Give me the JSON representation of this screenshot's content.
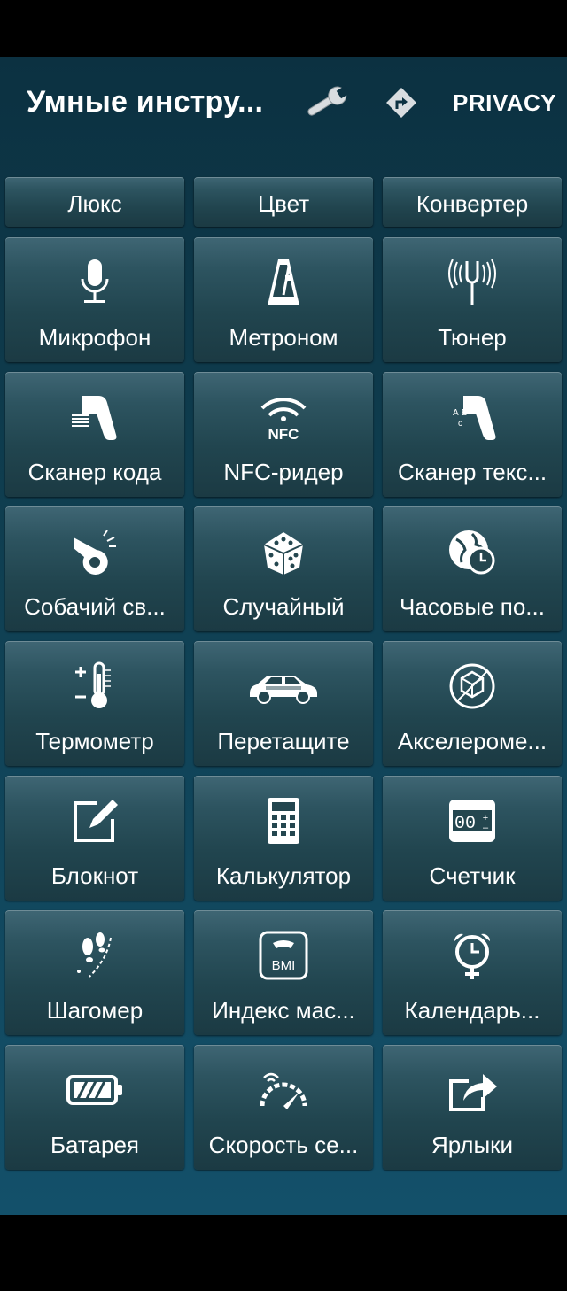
{
  "toolbar": {
    "title": "Умные инстру...",
    "wrench_icon": "wrench-icon",
    "directions_icon": "directions-icon",
    "privacy_label": "PRIVACY"
  },
  "tiles": [
    {
      "label": "Люкс",
      "icon": "none"
    },
    {
      "label": "Цвет",
      "icon": "none"
    },
    {
      "label": "Конвертер",
      "icon": "none"
    },
    {
      "label": "Микрофон",
      "icon": "microphone-icon"
    },
    {
      "label": "Метроном",
      "icon": "metronome-icon"
    },
    {
      "label": "Тюнер",
      "icon": "tuning-fork-icon"
    },
    {
      "label": "Сканер кода",
      "icon": "barcode-scanner-icon"
    },
    {
      "label": "NFC-ридер",
      "icon": "nfc-icon"
    },
    {
      "label": "Сканер текс...",
      "icon": "text-scanner-icon"
    },
    {
      "label": "Собачий св...",
      "icon": "whistle-icon"
    },
    {
      "label": "Случайный",
      "icon": "dice-icon"
    },
    {
      "label": "Часовые по...",
      "icon": "world-clock-icon"
    },
    {
      "label": "Термометр",
      "icon": "thermometer-icon"
    },
    {
      "label": "Перетащите",
      "icon": "taxi-car-icon"
    },
    {
      "label": "Акселероме...",
      "icon": "accelerometer-icon"
    },
    {
      "label": "Блокнот",
      "icon": "notepad-icon"
    },
    {
      "label": "Калькулятор",
      "icon": "calculator-icon"
    },
    {
      "label": "Счетчик",
      "icon": "counter-icon"
    },
    {
      "label": "Шагомер",
      "icon": "footsteps-icon"
    },
    {
      "label": "Индекс мас...",
      "icon": "bmi-scale-icon"
    },
    {
      "label": "Календарь...",
      "icon": "alarm-clock-icon"
    },
    {
      "label": "Батарея",
      "icon": "battery-icon"
    },
    {
      "label": "Скорость се...",
      "icon": "speedometer-icon"
    },
    {
      "label": "Ярлыки",
      "icon": "share-icon"
    }
  ],
  "bmi_text": "BMI",
  "nfc_text": "NFC",
  "counter_text": "00"
}
